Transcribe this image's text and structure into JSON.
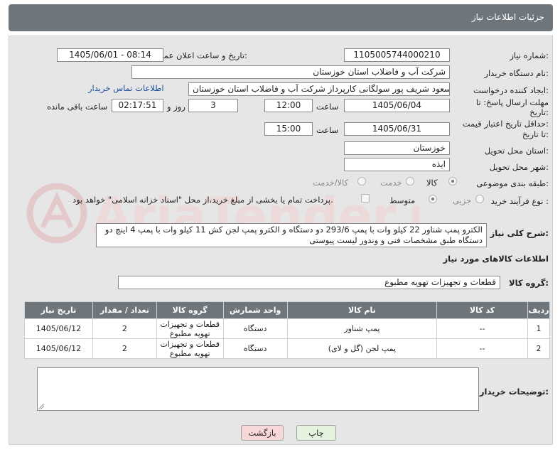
{
  "header": {
    "title": "جزئیات اطلاعات نیاز"
  },
  "form": {
    "need_number_label": "شماره نیاز:",
    "need_number": "1105005744000210",
    "announce_label": "تاریخ و ساعت اعلان عمومی:",
    "announce_value": "1405/06/01 - 08:14",
    "buyer_org_label": "نام دستگاه خریدار:",
    "buyer_org": "شرکت آب و فاضلاب استان خوزستان",
    "creator_label": "ایجاد کننده درخواست:",
    "creator": "مسعود شریف پور سولگانی کارپرداز شرکت آب و فاضلاب استان خوزستان",
    "contact_link": "اطلاعات تماس خریدار",
    "deadline_label_1": "مهلت ارسال پاسخ: تا",
    "deadline_label_2": "تاریخ:",
    "deadline_date": "1405/06/04",
    "time_label": "ساعت",
    "deadline_time": "12:00",
    "days_value": "3",
    "days_label": "روز و",
    "remaining_time": "02:17:51",
    "remaining_label": "ساعت باقی مانده",
    "validity_label_1": "حداقل تاریخ اعتبار قیمت:",
    "validity_label_2": "تا تاریخ:",
    "validity_date": "1405/06/31",
    "validity_time_label": "ساعت",
    "validity_time": "15:00",
    "province_label": "استان محل تحویل:",
    "province": "خوزستان",
    "city_label": "شهر محل تحویل:",
    "city": "ایذه",
    "category_label": "طبقه بندی موضوعی:",
    "category_options": [
      "کالا",
      "خدمت",
      "کالا/خدمت"
    ],
    "category_selected": "کالا",
    "process_label": "نوع فرآیند خرید :",
    "process_options": [
      "جزیی",
      "متوسط"
    ],
    "process_selected": "متوسط",
    "payment_note": "پرداخت تمام یا بخشی از مبلغ خرید،از محل \"اسناد خزانه اسلامی\" خواهد بود.",
    "description_label": "شرح کلی نیاز:",
    "description_line1": "الکترو پمپ شناور 22 کیلو وات با پمپ 293/6 دو دستگاه و الکترو پمپ لجن کش 11 کیلو وات با پمپ 4 اینچ دو",
    "description_line2": "دستگاه طبق مشخصات فنی و وندور لیست پیوستی"
  },
  "goods": {
    "section_title": "اطلاعات کالاهای مورد نیاز",
    "group_label": "گروه کالا:",
    "group_value": "قطعات و تجهیزات تهویه مطبوع",
    "columns": [
      "ردیف",
      "کد کالا",
      "نام کالا",
      "واحد شمارش",
      "گروه کالا",
      "تعداد / مقدار",
      "تاریخ نیاز"
    ],
    "rows": [
      {
        "row": "1",
        "code": "--",
        "name": "پمپ شناور",
        "unit": "دستگاه",
        "group_l1": "قطعات و تجهیزات",
        "group_l2": "تهویه مطبوع",
        "qty": "2",
        "date": "1405/06/12"
      },
      {
        "row": "2",
        "code": "--",
        "name": "پمپ لجن (گل و لای)",
        "unit": "دستگاه",
        "group_l1": "قطعات و تجهیزات",
        "group_l2": "تهویه مطبوع",
        "qty": "2",
        "date": "1405/06/12"
      }
    ]
  },
  "buyer_notes": {
    "label": "توضیحات خریدار:",
    "value": ""
  },
  "buttons": {
    "print": "چاپ",
    "back": "بازگشت"
  },
  "watermark": {
    "text": "AriaTender.neT"
  },
  "colors": {
    "header_bg": "#6f767b",
    "panel_bg": "#e6e6e6",
    "link": "#1d4f9c",
    "back_btn": "#f7d7d7",
    "print_btn": "#e3f3de",
    "watermark": "#e3c9c9"
  }
}
